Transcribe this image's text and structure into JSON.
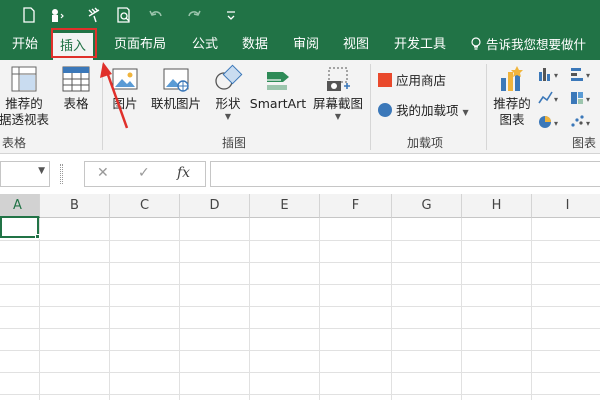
{
  "tabs": {
    "start": "开始",
    "insert": "插入",
    "page_layout": "页面布局",
    "formulas": "公式",
    "data": "数据",
    "review": "审阅",
    "view": "视图",
    "developer": "开发工具",
    "tell_me": "告诉我您想要做什"
  },
  "ribbon": {
    "recommended_pivot": [
      "推荐的",
      "据透视表"
    ],
    "table": "表格",
    "picture": "图片",
    "online_picture": "联机图片",
    "shapes": "形状",
    "smartart": "SmartArt",
    "screenshot": "屏幕截图",
    "app_store": "应用商店",
    "my_addins": "我的加载项",
    "recommended_charts": [
      "推荐的",
      "图表"
    ],
    "groups": {
      "tables": "表格",
      "illustrations": "插图",
      "addins": "加载项",
      "charts": "图表"
    }
  },
  "formula_bar": {
    "cancel": "✕",
    "enter": "✓",
    "fx": "fx"
  },
  "grid": {
    "columns": [
      "A",
      "B",
      "C",
      "D",
      "E",
      "F",
      "G",
      "H",
      "I"
    ]
  },
  "colors": {
    "brand": "#217346",
    "highlight": "#e0302b",
    "ribbon_bg": "#f3f3f3"
  }
}
